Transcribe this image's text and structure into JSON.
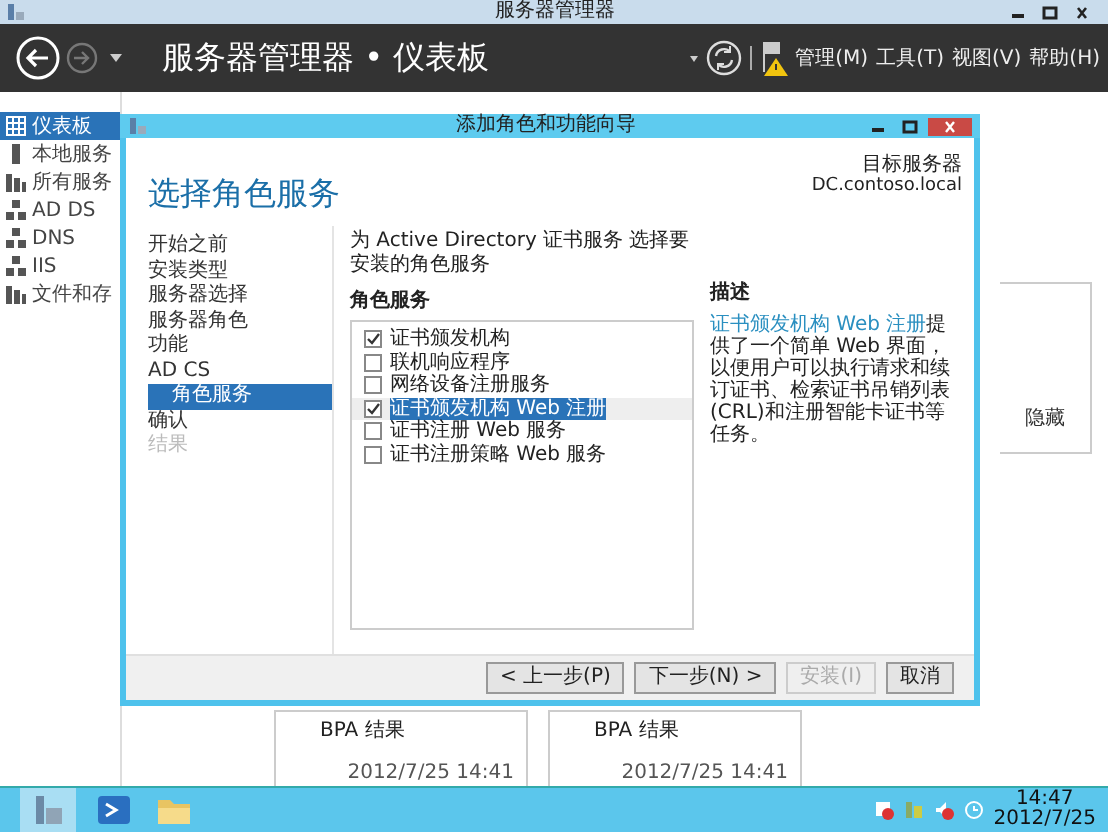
{
  "window": {
    "title": "服务器管理器"
  },
  "header": {
    "title": "服务器管理器 • 仪表板",
    "menus": [
      "管理(M)",
      "工具(T)",
      "视图(V)",
      "帮助(H)"
    ]
  },
  "sidebar": {
    "items": [
      {
        "label": "仪表板",
        "kind": "grid",
        "selected": true
      },
      {
        "label": "本地服务",
        "kind": "server",
        "selected": false
      },
      {
        "label": "所有服务",
        "kind": "servers",
        "selected": false
      },
      {
        "label": "AD DS",
        "kind": "role",
        "selected": false
      },
      {
        "label": "DNS",
        "kind": "role",
        "selected": false
      },
      {
        "label": "IIS",
        "kind": "role",
        "selected": false
      },
      {
        "label": "文件和存",
        "kind": "servers",
        "selected": false
      }
    ]
  },
  "dashboard": {
    "hide_link": "隐藏",
    "tiles": [
      {
        "title": "BPA 结果",
        "time": "2012/7/25 14:41"
      },
      {
        "title": "BPA 结果",
        "time": "2012/7/25 14:41"
      }
    ]
  },
  "dialog": {
    "title": "添加角色和功能向导",
    "heading": "选择角色服务",
    "target_label": "目标服务器",
    "target_server": "DC.contoso.local",
    "nav": [
      {
        "label": "开始之前",
        "selected": false,
        "disabled": false
      },
      {
        "label": "安装类型",
        "selected": false,
        "disabled": false
      },
      {
        "label": "服务器选择",
        "selected": false,
        "disabled": false
      },
      {
        "label": "服务器角色",
        "selected": false,
        "disabled": false
      },
      {
        "label": "功能",
        "selected": false,
        "disabled": false
      },
      {
        "label": "AD CS",
        "selected": false,
        "disabled": false,
        "children": [
          {
            "label": "角色服务",
            "selected": true,
            "disabled": false
          }
        ]
      },
      {
        "label": "确认",
        "selected": false,
        "disabled": false
      },
      {
        "label": "结果",
        "selected": false,
        "disabled": true
      }
    ],
    "instruction": "为 Active Directory 证书服务 选择要安装的角色服务",
    "list_label": "角色服务",
    "role_services": [
      {
        "label": "证书颁发机构",
        "checked": true,
        "selected": false
      },
      {
        "label": "联机响应程序",
        "checked": false,
        "selected": false
      },
      {
        "label": "网络设备注册服务",
        "checked": false,
        "selected": false
      },
      {
        "label": "证书颁发机构 Web 注册",
        "checked": true,
        "selected": true
      },
      {
        "label": "证书注册 Web 服务",
        "checked": false,
        "selected": false
      },
      {
        "label": "证书注册策略 Web 服务",
        "checked": false,
        "selected": false
      }
    ],
    "description_label": "描述",
    "description": {
      "link": "证书颁发机构 Web 注册",
      "text": "提供了一个简单 Web 界面，以便用户可以执行请求和续订证书、检索证书吊销列表(CRL)和注册智能卡证书等任务。"
    },
    "buttons": [
      {
        "label": "< 上一步(P)",
        "disabled": false
      },
      {
        "label": "下一步(N) >",
        "disabled": false
      },
      {
        "label": "安装(I)",
        "disabled": true
      },
      {
        "label": "取消",
        "disabled": false
      }
    ]
  },
  "taskbar": {
    "time": "14:47",
    "date": "2012/7/25"
  }
}
